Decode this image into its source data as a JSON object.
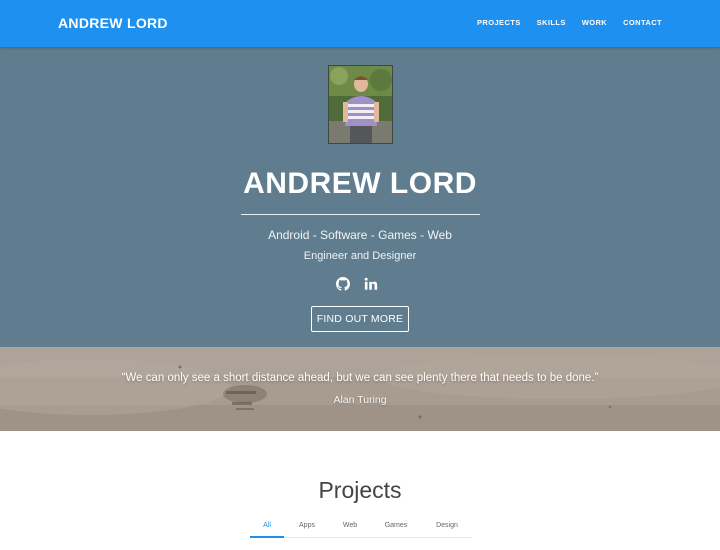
{
  "nav": {
    "brand": "ANDREW LORD",
    "links": [
      "PROJECTS",
      "SKILLS",
      "WORK",
      "CONTACT"
    ]
  },
  "hero": {
    "title": "ANDREW LORD",
    "tagline": "Android - Software - Games - Web",
    "subtitle": "Engineer and Designer",
    "social_icons": [
      "github-icon",
      "linkedin-icon"
    ],
    "cta_label": "FIND OUT MORE"
  },
  "quote": {
    "text": "“We can only see a short distance ahead, but we can see plenty there that needs to be done.”",
    "author": "Alan Turing"
  },
  "projects": {
    "title": "Projects",
    "tabs": [
      "All",
      "Apps",
      "Web",
      "Games",
      "Design"
    ],
    "active_tab": "All"
  },
  "colors": {
    "accent": "#1e90f0",
    "hero_bg": "#5f7d8e",
    "quote_bg": "#a99e92"
  }
}
